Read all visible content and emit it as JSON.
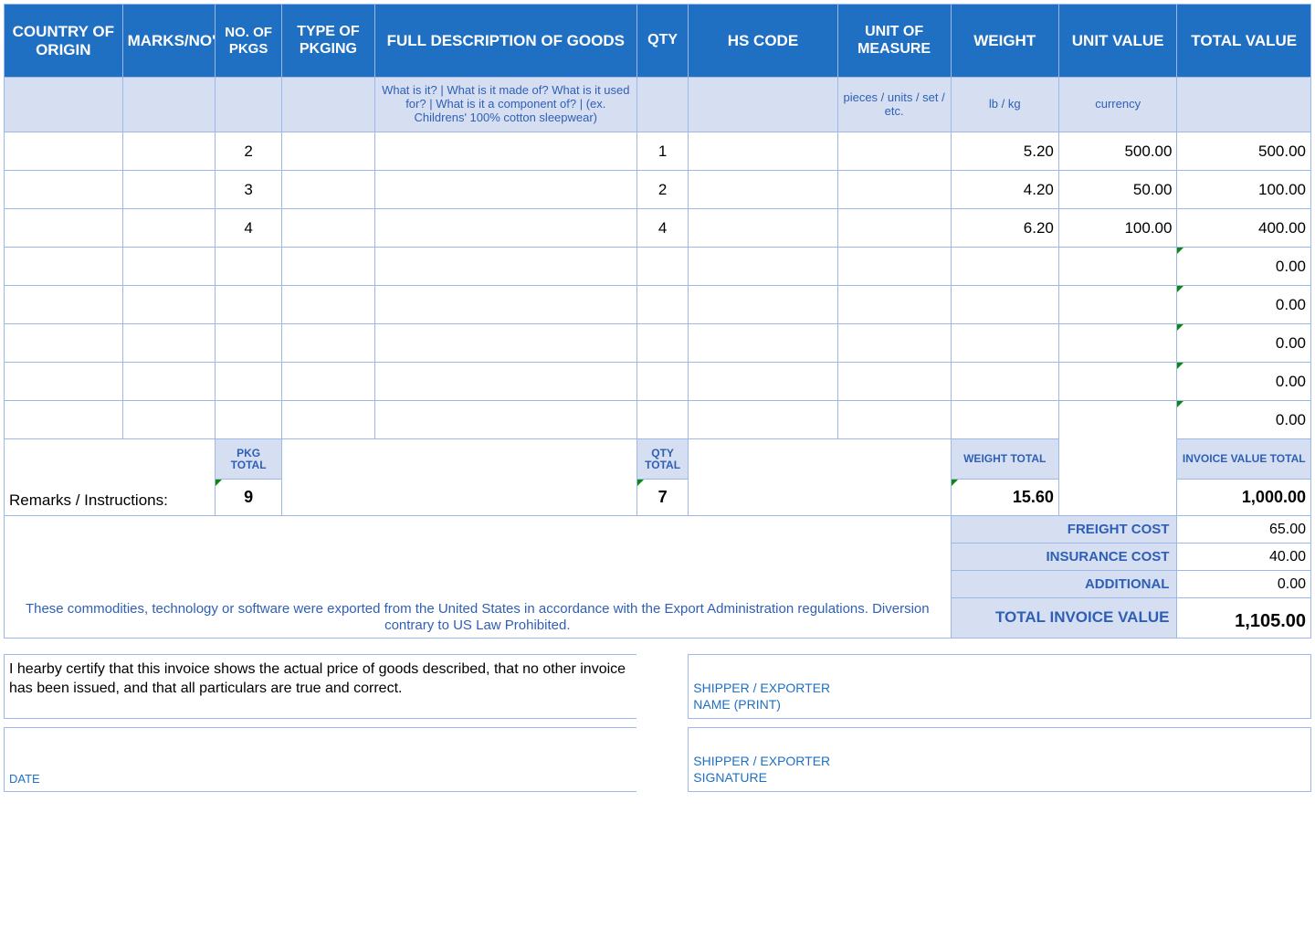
{
  "headers": {
    "country": "COUNTRY OF ORIGIN",
    "marks": "MARKS/NO's",
    "pkgs": "NO. OF PKGS",
    "pkging": "TYPE OF PKGING",
    "desc": "FULL DESCRIPTION OF GOODS",
    "qty": "QTY",
    "hs": "HS CODE",
    "uom": "UNIT OF MEASURE",
    "weight": "WEIGHT",
    "unitval": "UNIT VALUE",
    "totalval": "TOTAL VALUE"
  },
  "hints": {
    "desc": "What is it? | What is it made of? What is it used for? | What is it a component of? | (ex. Childrens' 100% cotton sleepwear)",
    "uom": "pieces / units / set / etc.",
    "weight": "lb / kg",
    "unitval": "currency"
  },
  "rows": [
    {
      "pkgs": "2",
      "qty": "1",
      "weight": "5.20",
      "unitval": "500.00",
      "totalval": "500.00"
    },
    {
      "pkgs": "3",
      "qty": "2",
      "weight": "4.20",
      "unitval": "50.00",
      "totalval": "100.00"
    },
    {
      "pkgs": "4",
      "qty": "4",
      "weight": "6.20",
      "unitval": "100.00",
      "totalval": "400.00"
    },
    {
      "pkgs": "",
      "qty": "",
      "weight": "",
      "unitval": "",
      "totalval": "0.00"
    },
    {
      "pkgs": "",
      "qty": "",
      "weight": "",
      "unitval": "",
      "totalval": "0.00"
    },
    {
      "pkgs": "",
      "qty": "",
      "weight": "",
      "unitval": "",
      "totalval": "0.00"
    },
    {
      "pkgs": "",
      "qty": "",
      "weight": "",
      "unitval": "",
      "totalval": "0.00"
    },
    {
      "pkgs": "",
      "qty": "",
      "weight": "",
      "unitval": "",
      "totalval": "0.00"
    }
  ],
  "subheaders": {
    "pkg": "PKG TOTAL",
    "qty": "QTY TOTAL",
    "weight": "WEIGHT TOTAL",
    "invoice": "INVOICE VALUE TOTAL"
  },
  "subtotals": {
    "pkg": "9",
    "qty": "7",
    "weight": "15.60",
    "invoice": "1,000.00"
  },
  "remarks_label": "Remarks / Instructions:",
  "costs": {
    "freight_label": "FREIGHT COST",
    "freight_val": "65.00",
    "insurance_label": "INSURANCE COST",
    "insurance_val": "40.00",
    "additional_label": "ADDITIONAL",
    "additional_val": "0.00",
    "total_label": "TOTAL INVOICE VALUE",
    "total_val": "1,105.00"
  },
  "export_note": "These commodities, technology or software were exported from the United States in accordance with the Export Administration regulations.  Diversion contrary to US Law Prohibited.",
  "certify": "I hearby certify that this invoice shows the actual price of goods described, that no other invoice has been issued, and that all particulars are true and correct.",
  "sig": {
    "name_l1": "SHIPPER / EXPORTER",
    "name_l2": "NAME (PRINT)",
    "sig_l1": "SHIPPER / EXPORTER",
    "sig_l2": "SIGNATURE",
    "date": "DATE"
  }
}
